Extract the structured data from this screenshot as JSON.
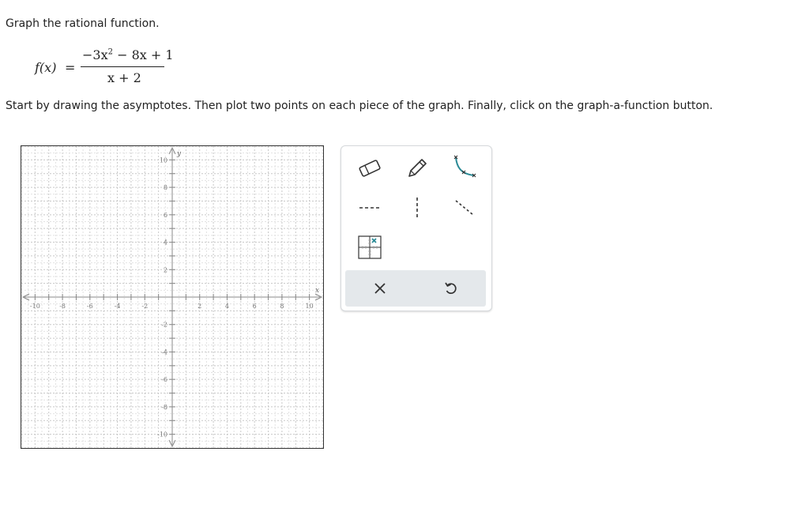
{
  "question": {
    "prompt": "Graph the rational function.",
    "formula_lhs": "f(x)",
    "formula_eq": "=",
    "numerator_a": "−3x",
    "numerator_exp": "2",
    "numerator_b": "− 8x + 1",
    "denominator": "x + 2",
    "instructions": "Start by drawing the asymptotes. Then plot two points on each piece of the graph. Finally, click on the graph-a-function button."
  },
  "graph": {
    "x_axis_label": "x",
    "y_axis_label": "y",
    "x_range": [
      -11,
      11
    ],
    "y_range": [
      -11,
      11
    ],
    "x_ticks": [
      "-10",
      "-8",
      "-6",
      "-4",
      "-2",
      "2",
      "4",
      "6",
      "8",
      "10"
    ],
    "y_ticks": [
      "10",
      "8",
      "6",
      "4",
      "2",
      "-2",
      "-4",
      "-6",
      "-8",
      "-10"
    ],
    "grid": true
  },
  "toolbox": {
    "tools": [
      {
        "name": "eraser-tool",
        "icon": "eraser-icon"
      },
      {
        "name": "pencil-tool",
        "icon": "pencil-icon"
      },
      {
        "name": "graph-function-tool",
        "icon": "graph-function-icon"
      },
      {
        "name": "horizontal-asymptote-tool",
        "icon": "horizontal-dashed-line-icon"
      },
      {
        "name": "vertical-asymptote-tool",
        "icon": "vertical-dashed-line-icon"
      },
      {
        "name": "slant-asymptote-tool",
        "icon": "slant-dashed-line-icon"
      },
      {
        "name": "point-tool",
        "icon": "point-grid-icon"
      }
    ],
    "actions": [
      {
        "name": "clear-button",
        "icon": "close-icon"
      },
      {
        "name": "undo-button",
        "icon": "undo-icon"
      }
    ],
    "accent_color": "#2a8a96"
  }
}
